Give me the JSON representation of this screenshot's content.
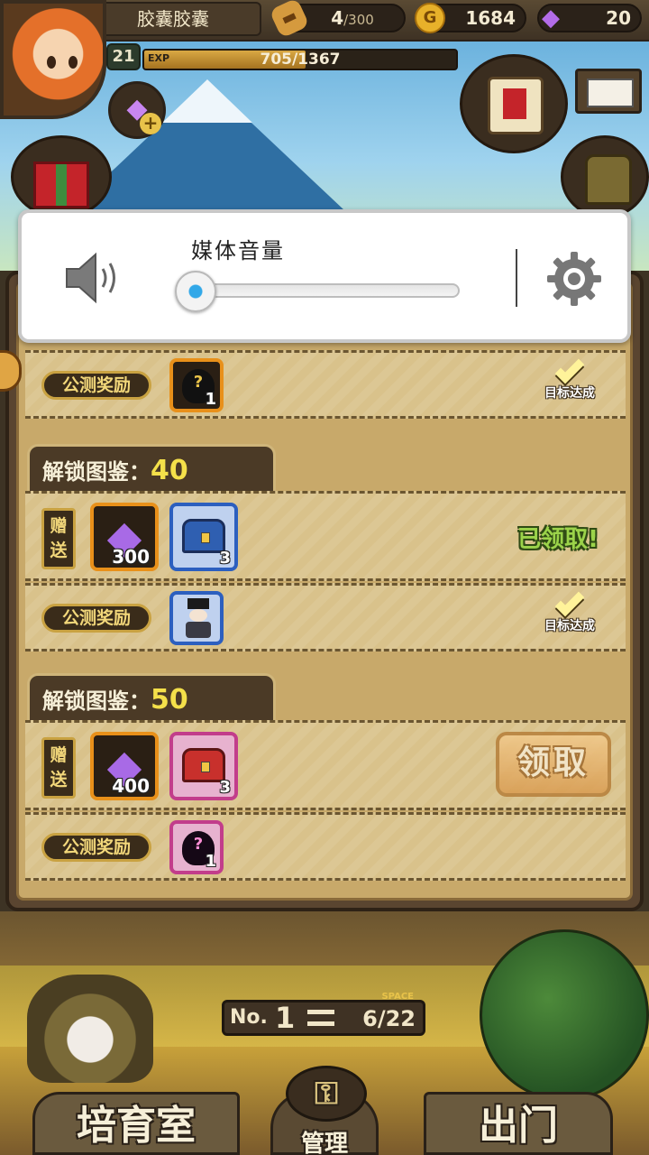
{
  "hud": {
    "player_name": "胶囊胶囊",
    "level": "21",
    "exp_label": "EXP",
    "exp_text": "705/1367",
    "exp_progress": 0.516,
    "bread_value": "4",
    "bread_max": "/300",
    "gold_value": "1684",
    "gold_icon": "G",
    "gem_value": "20"
  },
  "rewards": {
    "row1": {
      "beta_label": "公测奖励",
      "item_qty": "1",
      "goal_text": "目标达成"
    },
    "section2": {
      "label": "解锁图鉴：",
      "number": "40"
    },
    "row2": {
      "gift_label_1": "赠",
      "gift_label_2": "送",
      "gem_qty": "300",
      "chest_qty": "3",
      "status": "已领取!"
    },
    "row3": {
      "beta_label": "公测奖励",
      "goal_text": "目标达成"
    },
    "section3": {
      "label": "解锁图鉴：",
      "number": "50"
    },
    "row4": {
      "gift_label_1": "赠",
      "gift_label_2": "送",
      "gem_qty": "400",
      "chest_qty": "3",
      "claim_label": "领取"
    },
    "row5": {
      "beta_label": "公测奖励",
      "item_qty": "1"
    }
  },
  "bottom_nav": {
    "no_label": "No.",
    "no_value": "1",
    "space_label": "SPACE",
    "space_value": "6/22",
    "incubator": "培育室",
    "manage": "管理",
    "go_out": "出门"
  },
  "volume_overlay": {
    "title": "媒体音量",
    "level": 0.0,
    "accent_color": "#32a8e8"
  },
  "icons": {
    "speaker": "speaker-icon",
    "settings": "gear-icon",
    "question": "?"
  }
}
